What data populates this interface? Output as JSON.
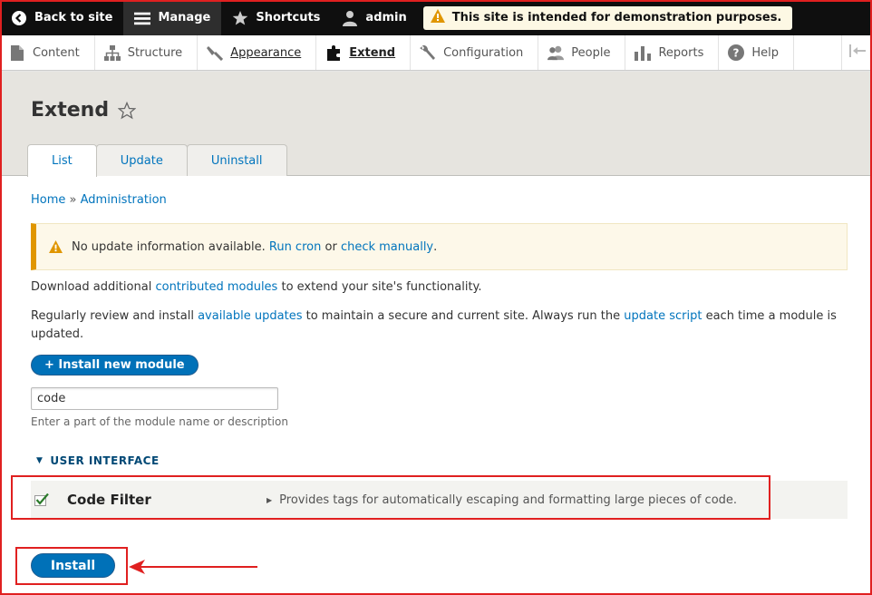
{
  "toolbar": {
    "back": "Back to site",
    "manage": "Manage",
    "shortcuts": "Shortcuts",
    "user": "admin",
    "notice": "This site is intended for demonstration purposes."
  },
  "tray": {
    "items": [
      {
        "label": "Content",
        "icon": "content-icon"
      },
      {
        "label": "Structure",
        "icon": "structure-icon"
      },
      {
        "label": "Appearance",
        "icon": "appearance-icon"
      },
      {
        "label": "Extend",
        "icon": "extend-icon"
      },
      {
        "label": "Configuration",
        "icon": "configuration-icon"
      },
      {
        "label": "People",
        "icon": "people-icon"
      },
      {
        "label": "Reports",
        "icon": "reports-icon"
      },
      {
        "label": "Help",
        "icon": "help-icon"
      }
    ]
  },
  "page": {
    "title": "Extend",
    "tabs": [
      {
        "label": "List"
      },
      {
        "label": "Update"
      },
      {
        "label": "Uninstall"
      }
    ]
  },
  "breadcrumb": {
    "home": "Home",
    "sep": "»",
    "admin": "Administration"
  },
  "message": {
    "text": "No update information available.",
    "link1": "Run cron",
    "or": "or",
    "link2": "check manually",
    "end": "."
  },
  "para1": {
    "before": "Download additional",
    "link": "contributed modules",
    "after": "to extend your site's functionality."
  },
  "para2": {
    "before": "Regularly review and install",
    "link1": "available updates",
    "middle": "to maintain a secure and current site. Always run the",
    "link2": "update script",
    "after": "each time a module is updated."
  },
  "install_new": "+ Install new module",
  "filter": {
    "value": "code",
    "description": "Enter a part of the module name or description"
  },
  "group": {
    "label": "USER INTERFACE"
  },
  "module": {
    "name": "Code Filter",
    "description": "Provides tags for automatically escaping and formatting large pieces of code."
  },
  "install_button": "Install",
  "colors": {
    "accent": "#0071b8",
    "annotation": "#e02020",
    "warning": "#e09600"
  }
}
